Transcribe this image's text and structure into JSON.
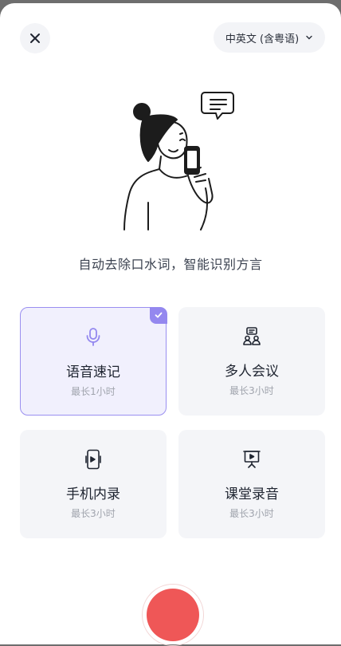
{
  "header": {
    "language_label": "中英文 (含粤语)"
  },
  "subtitle": "自动去除口水词，智能识别方言",
  "modes": [
    {
      "title": "语音速记",
      "subtitle": "最长1小时",
      "icon": "microphone-icon",
      "selected": true
    },
    {
      "title": "多人会议",
      "subtitle": "最长3小时",
      "icon": "meeting-people-icon",
      "selected": false
    },
    {
      "title": "手机内录",
      "subtitle": "最长3小时",
      "icon": "phone-recording-icon",
      "selected": false
    },
    {
      "title": "课堂录音",
      "subtitle": "最长3小时",
      "icon": "presentation-board-icon",
      "selected": false
    }
  ],
  "colors": {
    "accent": "#9488ef",
    "record": "#ef5757",
    "card_bg": "#f4f5f8"
  }
}
